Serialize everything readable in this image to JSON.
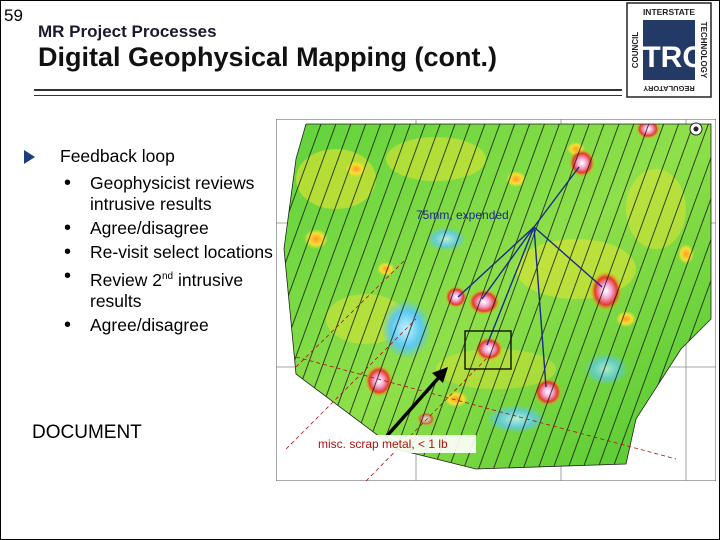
{
  "slide": {
    "number": "59",
    "subtitle": "MR Project Processes",
    "title": "Digital Geophysical Mapping (cont.)"
  },
  "logo": {
    "letters": "ITRC",
    "top_text": "INTERSTATE",
    "left_text": "COUNCIL",
    "right_text": "TECHNOLOGY",
    "bottom_text": "REGULATORY"
  },
  "content": {
    "bullet": "Feedback loop",
    "subbullets": [
      "Geophysicist reviews intrusive results",
      "Agree/disagree",
      "Re-visit select locations",
      "Review 2",
      "Agree/disagree"
    ],
    "subbullet4_sup": "nd",
    "subbullet4_rest": " intrusive results",
    "footer": "DOCUMENT"
  },
  "map": {
    "label_expended": "75mm, expended",
    "label_scrap": "misc. scrap metal, < 1 lb"
  },
  "colors": {
    "title": "#111111",
    "bullet_arrow": "#1c3f7a",
    "callout_lines": "#1a2a8a",
    "scrap_label": "#b01010",
    "anomaly": "#f0a0c8"
  }
}
